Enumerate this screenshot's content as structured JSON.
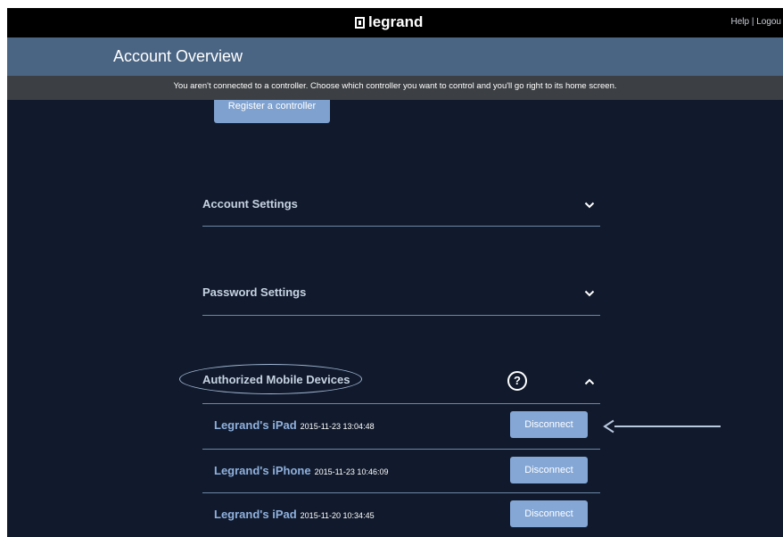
{
  "header": {
    "logo_text": "legrand",
    "help_logout": "Help | Logou"
  },
  "titlebar": {
    "title": "Account Overview"
  },
  "notice": {
    "text": "You aren't connected to a controller. Choose which controller you want to control and you'll go right to its home screen."
  },
  "register_button": {
    "label": "Register a controller"
  },
  "sections": {
    "account_settings": {
      "title": "Account Settings",
      "icon": "chevron-down-icon"
    },
    "password_settings": {
      "title": "Password Settings",
      "icon": "chevron-down-icon"
    },
    "authorized_devices": {
      "title": "Authorized Mobile Devices",
      "help": "?",
      "icon": "chevron-up-icon"
    }
  },
  "devices": [
    {
      "name": "Legrand's iPad",
      "timestamp": "2015-11-23 13:04:48",
      "action": "Disconnect"
    },
    {
      "name": "Legrand's iPhone",
      "timestamp": "2015-11-23 10:46:09",
      "action": "Disconnect"
    },
    {
      "name": "Legrand's iPad",
      "timestamp": "2015-11-20 10:34:45",
      "action": "Disconnect"
    }
  ],
  "colors": {
    "background": "#111a2c",
    "titlebar": "#4a6583",
    "notice_bar": "#3c3f43",
    "accent_button": "#84a7d6",
    "device_name": "#8fb0dd"
  }
}
